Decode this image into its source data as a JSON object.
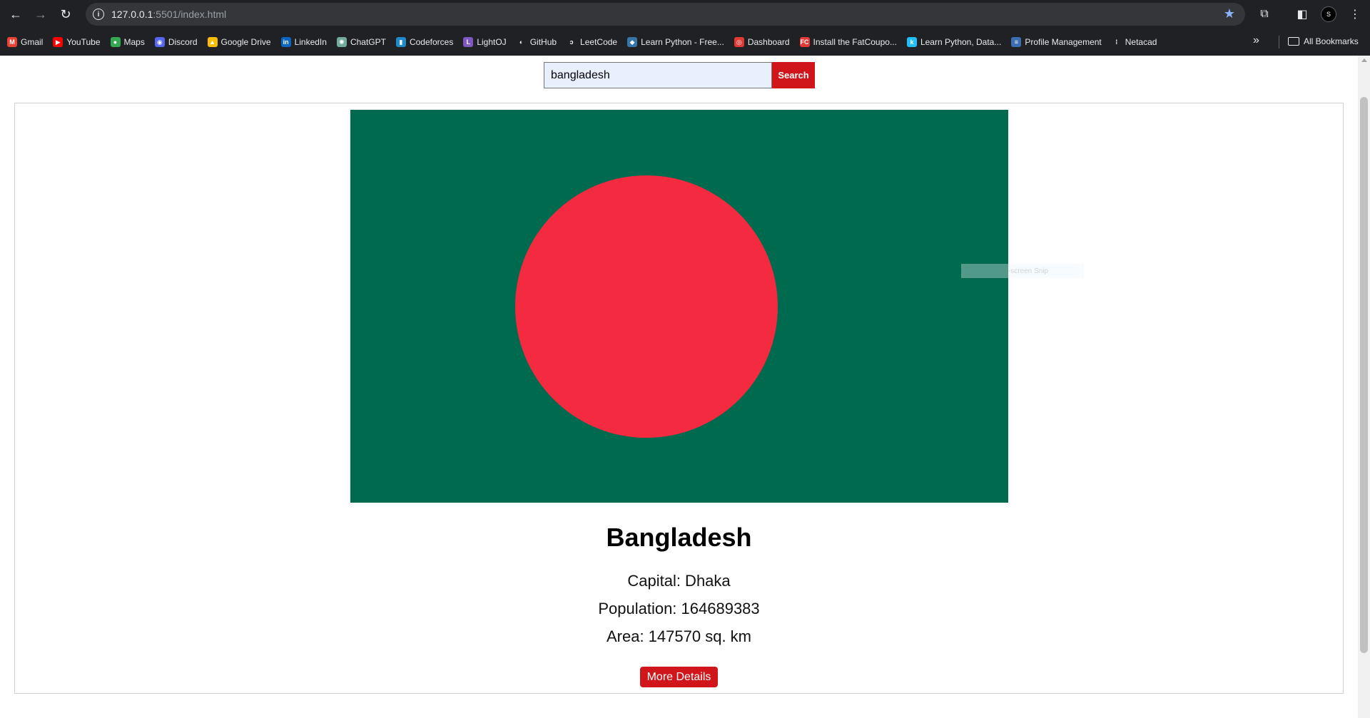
{
  "browser": {
    "url_host": "127.0.0.1",
    "url_rest": ":5501/index.html",
    "profile_initial": "S",
    "bookmarks": [
      {
        "label": "Gmail",
        "icon": "gmail-icon",
        "color": "#ea4335",
        "glyph": "M"
      },
      {
        "label": "YouTube",
        "icon": "youtube-icon",
        "color": "#ff0000",
        "glyph": "▶"
      },
      {
        "label": "Maps",
        "icon": "maps-icon",
        "color": "#34a853",
        "glyph": "●"
      },
      {
        "label": "Discord",
        "icon": "discord-icon",
        "color": "#5865f2",
        "glyph": "◉"
      },
      {
        "label": "Google Drive",
        "icon": "google-drive-icon",
        "color": "#fbbc04",
        "glyph": "▲"
      },
      {
        "label": "LinkedIn",
        "icon": "linkedin-icon",
        "color": "#0a66c2",
        "glyph": "in"
      },
      {
        "label": "ChatGPT",
        "icon": "chatgpt-icon",
        "color": "#74aa9c",
        "glyph": "✺"
      },
      {
        "label": "Codeforces",
        "icon": "codeforces-icon",
        "color": "#1f8acb",
        "glyph": "▮"
      },
      {
        "label": "LightOJ",
        "icon": "lightoj-icon",
        "color": "#7e57c2",
        "glyph": "L"
      },
      {
        "label": "GitHub",
        "icon": "github-icon",
        "color": "#202124",
        "glyph": "◐"
      },
      {
        "label": "LeetCode",
        "icon": "leetcode-icon",
        "color": "#202124",
        "glyph": "ↄ"
      },
      {
        "label": "Learn Python - Free...",
        "icon": "python-icon",
        "color": "#3776ab",
        "glyph": "◆"
      },
      {
        "label": "Dashboard",
        "icon": "dashboard-icon",
        "color": "#e53935",
        "glyph": "◎"
      },
      {
        "label": "Install the FatCoupo...",
        "icon": "fatcoupon-icon",
        "color": "#e53935",
        "glyph": "FC"
      },
      {
        "label": "Learn Python, Data...",
        "icon": "kaggle-icon",
        "color": "#20beff",
        "glyph": "k"
      },
      {
        "label": "Profile Management",
        "icon": "profile-management-icon",
        "color": "#3c6eb4",
        "glyph": "≡"
      },
      {
        "label": "Netacad",
        "icon": "netacad-icon",
        "color": "#202124",
        "glyph": "⁞"
      }
    ],
    "all_bookmarks_label": "All Bookmarks"
  },
  "search": {
    "value": "bangladesh",
    "button_label": "Search"
  },
  "country": {
    "name": "Bangladesh",
    "capital_line": "Capital: Dhaka",
    "population_line": "Population: 164689383",
    "area_line": "Area: 147570 sq. km",
    "more_button": "More Details",
    "flag_colors": {
      "field": "#006a4e",
      "disc": "#f42a41"
    }
  },
  "overlay": {
    "snip_text": "Full-screen Snip"
  },
  "colors": {
    "accent": "#d0161b"
  }
}
